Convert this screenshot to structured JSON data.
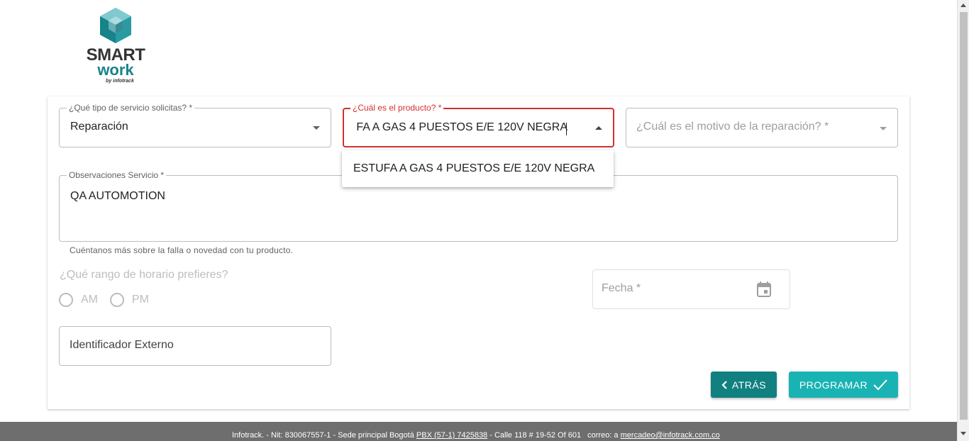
{
  "logo": {
    "brand_line1": "SMART",
    "brand_line2": "work",
    "brand_line3": "by infotrack",
    "colors": {
      "teal": "#17838b",
      "dark": "#333333",
      "light_teal": "#35a5b0"
    }
  },
  "form": {
    "service_type": {
      "label": "¿Qué tipo de servicio solicitas? *",
      "value": "Reparación"
    },
    "product": {
      "label": "¿Cuál es el producto? *",
      "value": "ESTUFA A GAS 4 PUESTOS E/E 120V NEGRA",
      "visible_text": "FA A GAS 4 PUESTOS E/E 120V NEGRA"
    },
    "reason": {
      "placeholder": "¿Cuál es el motivo de la reparación? *"
    },
    "observations": {
      "label": "Observaciones Servicio *",
      "value": "QA AUTOMOTION",
      "helper": "Cuéntanos más sobre la falla o novedad con tu producto."
    },
    "schedule": {
      "question": "¿Qué rango de horario prefieres?",
      "options": [
        "AM",
        "PM"
      ]
    },
    "date": {
      "placeholder": "Fecha *",
      "icon": "calendar-icon"
    },
    "external_id": {
      "placeholder": "Identificador Externo"
    }
  },
  "dropdown": {
    "options": [
      "ESTUFA A GAS 4 PUESTOS E/E 120V NEGRA"
    ]
  },
  "buttons": {
    "back": "ATRÁS",
    "schedule": "PROGRAMAR",
    "colors": {
      "back": "#118080",
      "schedule": "#1ab3b3"
    }
  },
  "footer": {
    "part1": "Infotrack. - Nit: 830067557-1 - Sede principal Bogotá",
    "phone": "PBX (57-1) 7425838",
    "part2": "- Calle 118 # 19-52 Of 601",
    "email_prefix": "correo: a",
    "email": "mercadeo@infotrack.com.co"
  },
  "colors": {
    "error": "#d32f2f",
    "footer_bg": "#6e6e6e"
  }
}
